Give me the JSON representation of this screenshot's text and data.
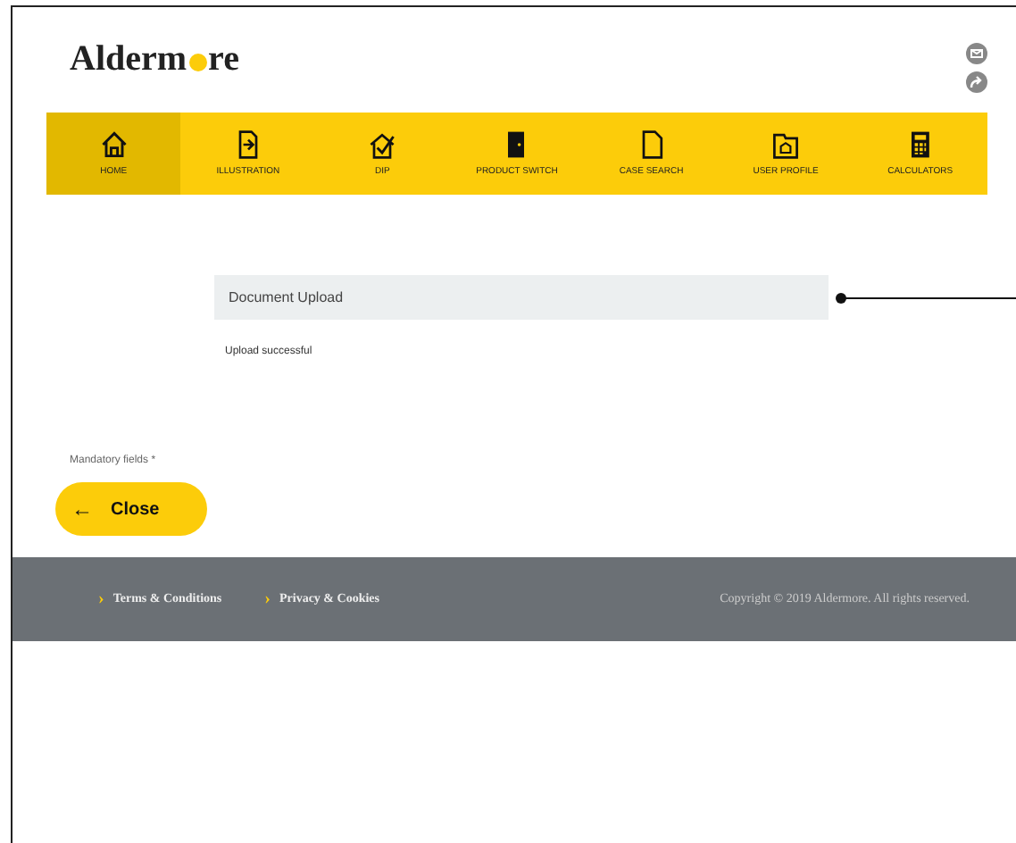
{
  "logo": {
    "before": "Alderm",
    "after": "re"
  },
  "nav": [
    {
      "label": "HOME",
      "selected": true
    },
    {
      "label": "ILLUSTRATION",
      "selected": false
    },
    {
      "label": "DIP",
      "selected": false
    },
    {
      "label": "PRODUCT SWITCH",
      "selected": false
    },
    {
      "label": "CASE SEARCH",
      "selected": false
    },
    {
      "label": "USER PROFILE",
      "selected": false
    },
    {
      "label": "CALCULATORS",
      "selected": false
    }
  ],
  "panel": {
    "title": "Document Upload",
    "message": "Upload successful"
  },
  "mandatory_note": "Mandatory fields *",
  "close_button": {
    "arrow": "←",
    "label": "Close"
  },
  "footer": {
    "links": [
      {
        "marker": "›",
        "label": "Terms & Conditions"
      },
      {
        "marker": "›",
        "label": "Privacy & Cookies"
      }
    ],
    "copyright": "Copyright © 2019 Aldermore. All rights reserved."
  }
}
